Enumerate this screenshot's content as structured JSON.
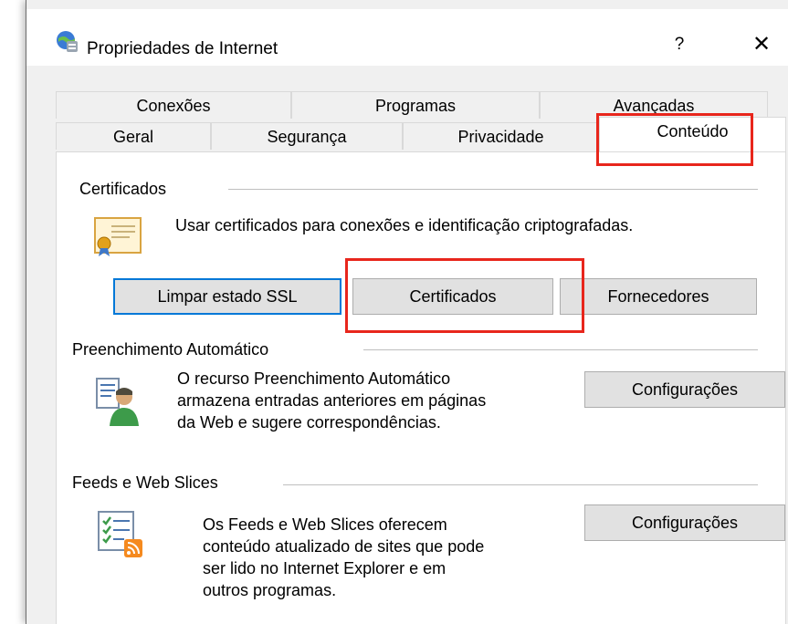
{
  "window": {
    "title": "Propriedades de Internet",
    "help_label": "?",
    "close_label": "✕"
  },
  "tabs": {
    "top_row": [
      "Conexões",
      "Programas",
      "Avançadas"
    ],
    "bottom_row": [
      "Geral",
      "Segurança",
      "Privacidade",
      "Conteúdo"
    ],
    "active": "Conteúdo"
  },
  "certificates": {
    "label": "Certificados",
    "description": "Usar certificados para conexões e identificação criptografadas.",
    "buttons": {
      "clear_ssl": "Limpar estado SSL",
      "certificates": "Certificados",
      "publishers": "Fornecedores"
    }
  },
  "autocomplete": {
    "label": "Preenchimento Automático",
    "description_lines": [
      "O recurso Preenchimento Automático",
      "armazena entradas anteriores em páginas",
      "da Web e sugere correspondências."
    ],
    "settings_button": "Configurações"
  },
  "feeds": {
    "label": "Feeds e Web Slices",
    "description_lines": [
      "Os Feeds e Web Slices oferecem",
      "conteúdo atualizado de sites que pode",
      "ser lido no Internet Explorer e em",
      "outros programas."
    ],
    "settings_button": "Configurações"
  },
  "colors": {
    "highlight": "#e8261c",
    "focus": "#0078d7"
  }
}
